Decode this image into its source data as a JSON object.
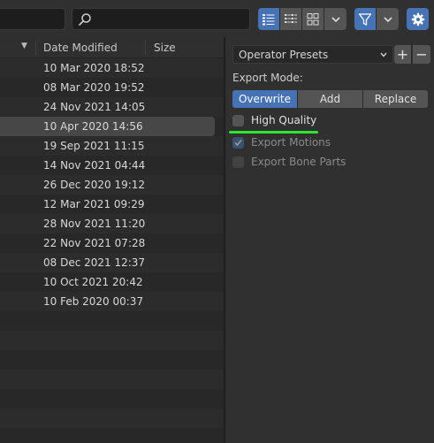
{
  "toolbar": {
    "search_value": "",
    "view_modes": [
      {
        "name": "vertical-list-view",
        "active": true
      },
      {
        "name": "horizontal-list-view",
        "active": false
      },
      {
        "name": "thumbnail-view",
        "active": false
      }
    ],
    "filter_active": true,
    "settings_active": true
  },
  "file_list": {
    "columns": {
      "date": "Date Modified",
      "size": "Size"
    },
    "sort_indicator": "▼",
    "selected_index": 3,
    "rows": [
      "10 Mar 2020 18:52",
      "08 Mar 2020 19:52",
      "24 Nov 2021 14:05",
      "10 Apr 2020 14:56",
      "19 Sep 2021 11:15",
      "14 Nov 2021 04:44",
      "26 Dec 2020 19:12",
      "12 Mar 2021 09:29",
      "28 Nov 2021 11:20",
      "22 Nov 2021 07:28",
      "08 Dec 2021 12:37",
      "10 Oct 2021 20:42",
      "10 Feb 2020 00:37",
      "",
      "",
      "",
      "",
      "",
      "",
      ""
    ]
  },
  "options": {
    "preset_label": "Operator Presets",
    "add_label": "+",
    "remove_label": "−",
    "export_mode_label": "Export Mode:",
    "modes": [
      "Overwrite",
      "Add",
      "Replace"
    ],
    "active_mode": "Overwrite",
    "checkboxes": [
      {
        "label": "High Quality",
        "checked": false,
        "enabled": true
      },
      {
        "label": "Export Motions",
        "checked": true,
        "enabled": false
      },
      {
        "label": "Export Bone Parts",
        "checked": false,
        "enabled": false
      }
    ]
  },
  "colors": {
    "accent": "#4772b3",
    "highlight_underline": "#2ee62e"
  }
}
